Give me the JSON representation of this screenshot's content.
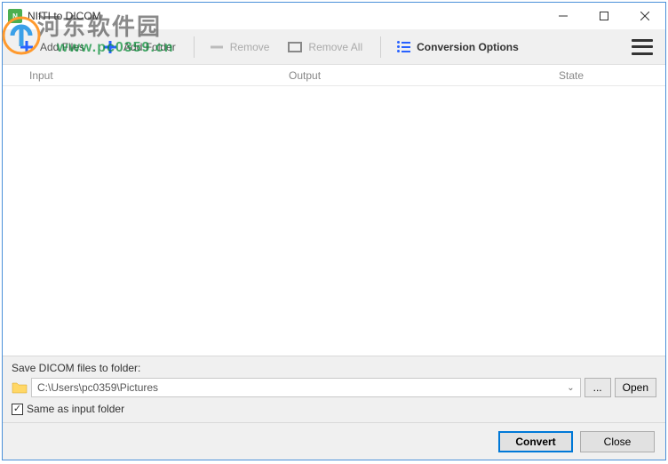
{
  "window": {
    "title": "NIfTI to DICOM"
  },
  "toolbar": {
    "add_files": "Add Files",
    "add_folder": "Add Folder",
    "remove": "Remove",
    "remove_all": "Remove All",
    "conversion_options": "Conversion Options"
  },
  "columns": {
    "input": "Input",
    "output": "Output",
    "state": "State"
  },
  "save_panel": {
    "label": "Save DICOM files to folder:",
    "path": "C:\\Users\\pc0359\\Pictures",
    "browse": "...",
    "open": "Open",
    "same_as_input": "Same as input folder"
  },
  "footer": {
    "convert": "Convert",
    "close": "Close"
  },
  "watermark": {
    "cn": "河东软件园",
    "url": "www.pc0359.cn"
  }
}
